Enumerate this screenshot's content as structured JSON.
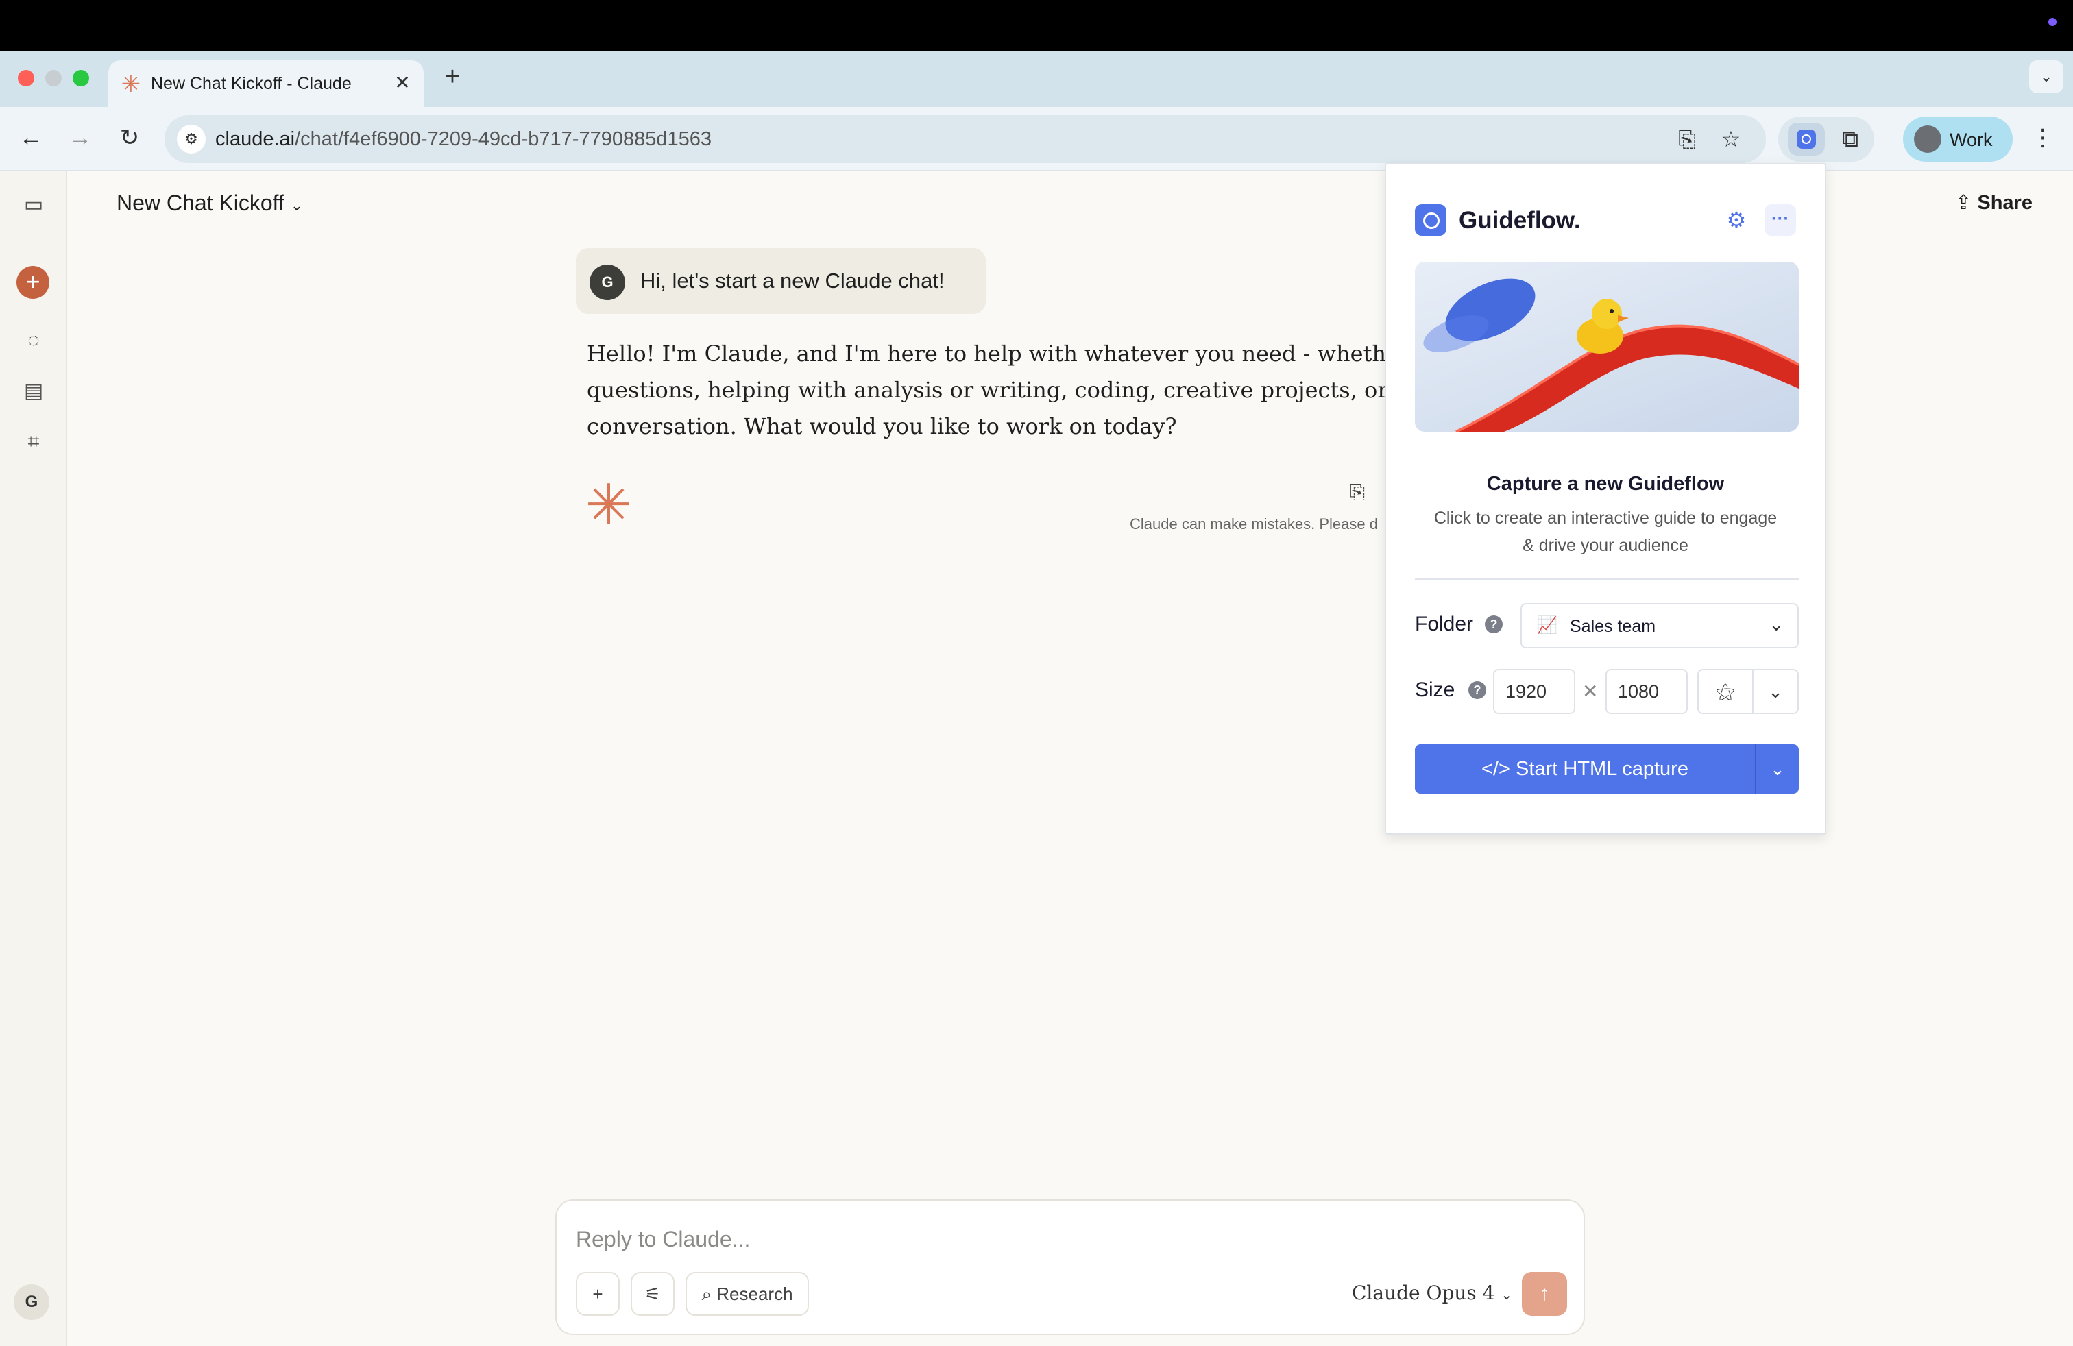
{
  "browser": {
    "tab_title": "New Chat Kickoff - Claude",
    "url_domain": "claude.ai",
    "url_path": "/chat/f4ef6900-7209-49cd-b717-7790885d1563",
    "profile_label": "Work"
  },
  "chat": {
    "title": "New Chat Kickoff",
    "share_label": "Share",
    "user_initial": "G",
    "user_message": "Hi, let's start a new Claude chat!",
    "assistant_lines": [
      "Hello! I'm Claude, and I'm here to help with whatever you need - whether that's a",
      "questions, helping with analysis or writing, coding, creative projects, or just havi",
      "conversation. What would you like to work on today?"
    ],
    "disclaimer": "Claude can make mistakes. Please d"
  },
  "composer": {
    "placeholder": "Reply to Claude...",
    "research_label": "Research",
    "model_label": "Claude Opus 4"
  },
  "sidebar": {
    "user_initial": "G"
  },
  "guideflow": {
    "brand": "Guideflow.",
    "heading": "Capture a new Guideflow",
    "description": "Click to create an interactive guide to engage & drive your audience",
    "folder_label": "Folder",
    "folder_value": "Sales team",
    "size_label": "Size",
    "width": "1920",
    "height": "1080",
    "start_label": "Start HTML capture"
  },
  "icons": {
    "tab_favicon": "claude-sparkle-icon",
    "extension": "guideflow-extension-icon",
    "puzzle": "extensions-puzzle-icon",
    "gear": "gear-icon",
    "more": "more-icon"
  },
  "colors": {
    "claude_accent": "#d97757",
    "guideflow_blue": "#4f73e8",
    "send_button": "#e4a48c"
  }
}
